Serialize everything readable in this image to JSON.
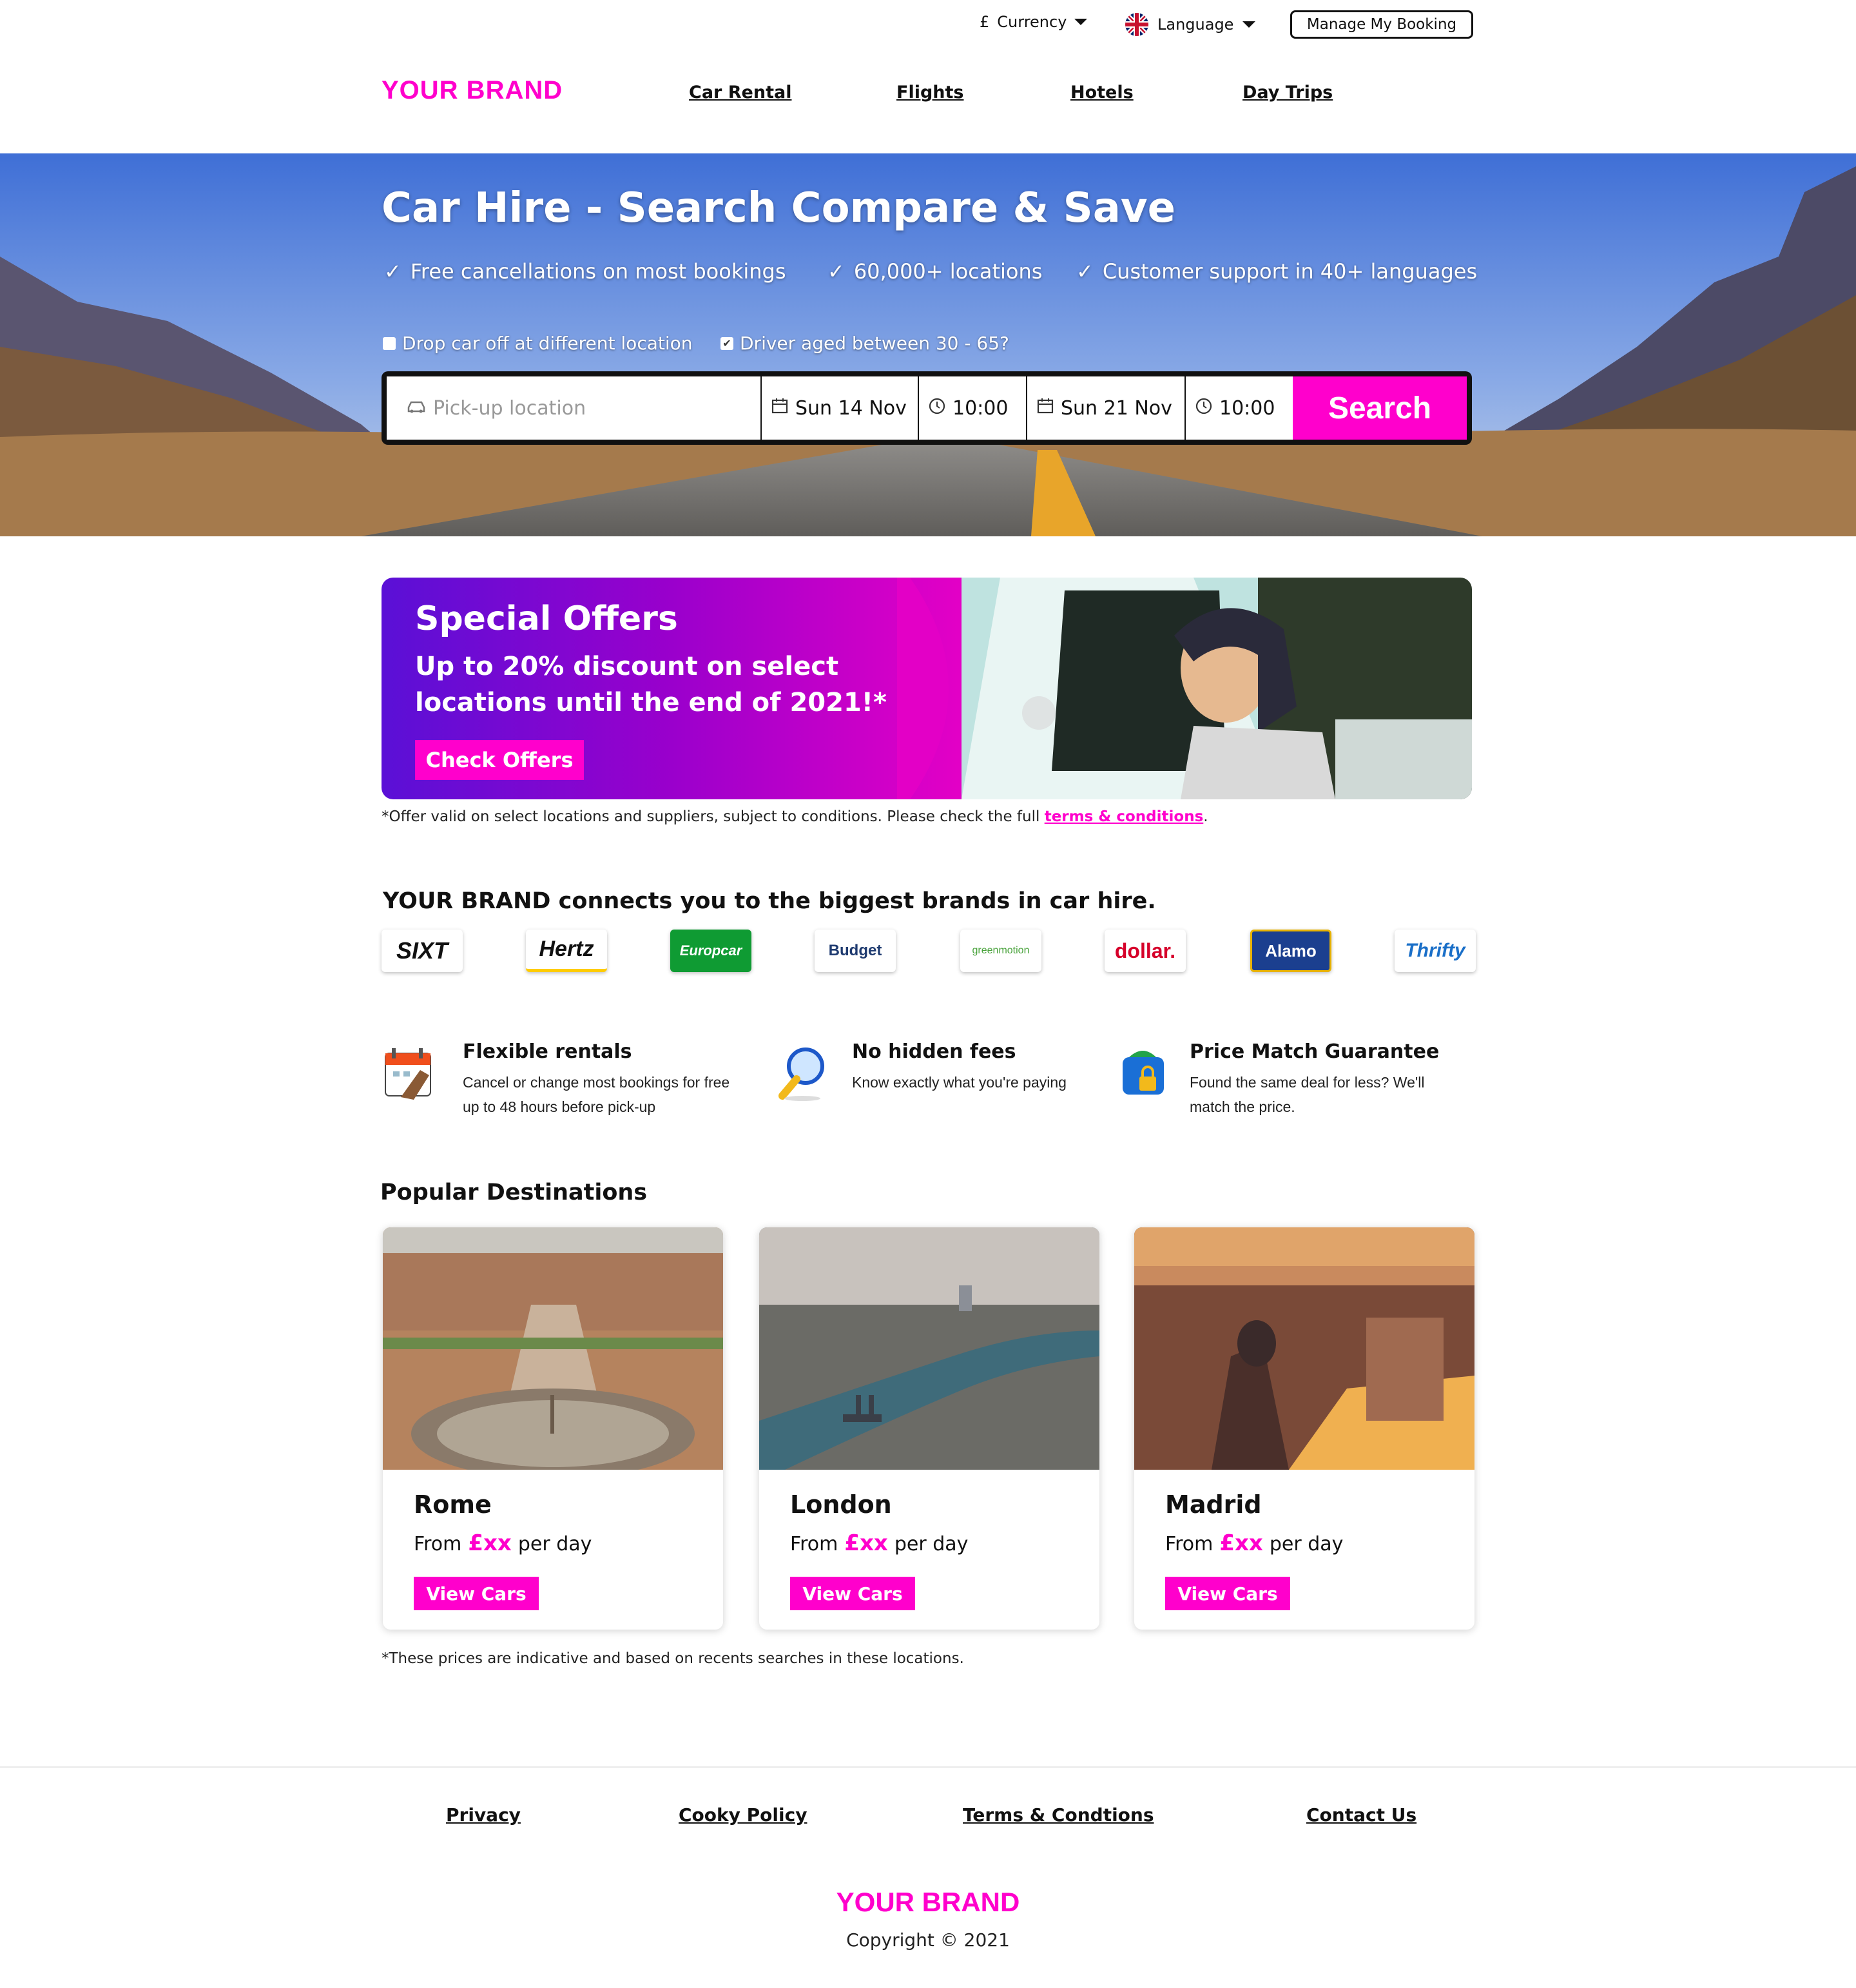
{
  "topbar": {
    "currency_symbol": "£",
    "currency_label": "Currency",
    "language_label": "Language",
    "manage_label": "Manage My Booking"
  },
  "header": {
    "brand": "YOUR BRAND",
    "nav": [
      "Car Rental",
      "Flights",
      "Hotels",
      "Day Trips"
    ]
  },
  "hero": {
    "title": "Car Hire - Search Compare & Save",
    "usps": [
      "Free cancellations on most bookings",
      "60,000+ locations",
      "Customer support in 40+ languages"
    ],
    "checkbox_dropoff": "Drop car off at different location",
    "checkbox_dropoff_checked": false,
    "checkbox_age": "Driver aged between 30 - 65?",
    "checkbox_age_checked": true,
    "pickup_placeholder": "Pick-up location",
    "pickup_date": "Sun 14 Nov",
    "pickup_time": "10:00",
    "dropoff_date": "Sun 21 Nov",
    "dropoff_time": "10:00",
    "search_label": "Search"
  },
  "offer": {
    "title": "Special Offers",
    "text": "Up to 20% discount on select locations until the end of 2021!*",
    "button": "Check Offers",
    "note": "*Offer valid on select locations and suppliers, subject to conditions. Please check the full",
    "note_link": "terms & conditions",
    "note_end": "."
  },
  "brands": {
    "title": "YOUR BRAND connects you to the biggest brands in car hire.",
    "logos": [
      "SIXT",
      "Hertz",
      "Europcar",
      "Budget",
      "greenmotion",
      "dollar.",
      "Alamo",
      "Thrifty"
    ]
  },
  "features": [
    {
      "title": "Flexible rentals",
      "text": "Cancel or change most bookings for free up to 48 hours before pick-up",
      "icon": "calendar-icon"
    },
    {
      "title": "No hidden fees",
      "text": "Know exactly what you're paying",
      "icon": "magnifier-icon"
    },
    {
      "title": "Price Match Guarantee",
      "text": "Found the same deal for less? We'll match the price.",
      "icon": "wallet-lock-icon"
    }
  ],
  "popular": {
    "title": "Popular Destinations",
    "cards": [
      {
        "city": "Rome",
        "from": "From",
        "price": "£xx",
        "per": "per day",
        "button": "View Cars"
      },
      {
        "city": "London",
        "from": "From",
        "price": "£xx",
        "per": "per day",
        "button": "View Cars"
      },
      {
        "city": "Madrid",
        "from": "From",
        "price": "£xx",
        "per": "per day",
        "button": "View Cars"
      }
    ],
    "note": "*These prices are indicative and based on recents searches in these locations."
  },
  "footer": {
    "links": [
      "Privacy",
      "Cooky Policy",
      "Terms & Condtions",
      "Contact Us"
    ],
    "brand": "YOUR BRAND",
    "copyright": "Copyright © 2021"
  },
  "colors": {
    "accent": "#ff00cc",
    "hero_sky": "#4f7fdc",
    "offer_start": "#5a10d6"
  }
}
